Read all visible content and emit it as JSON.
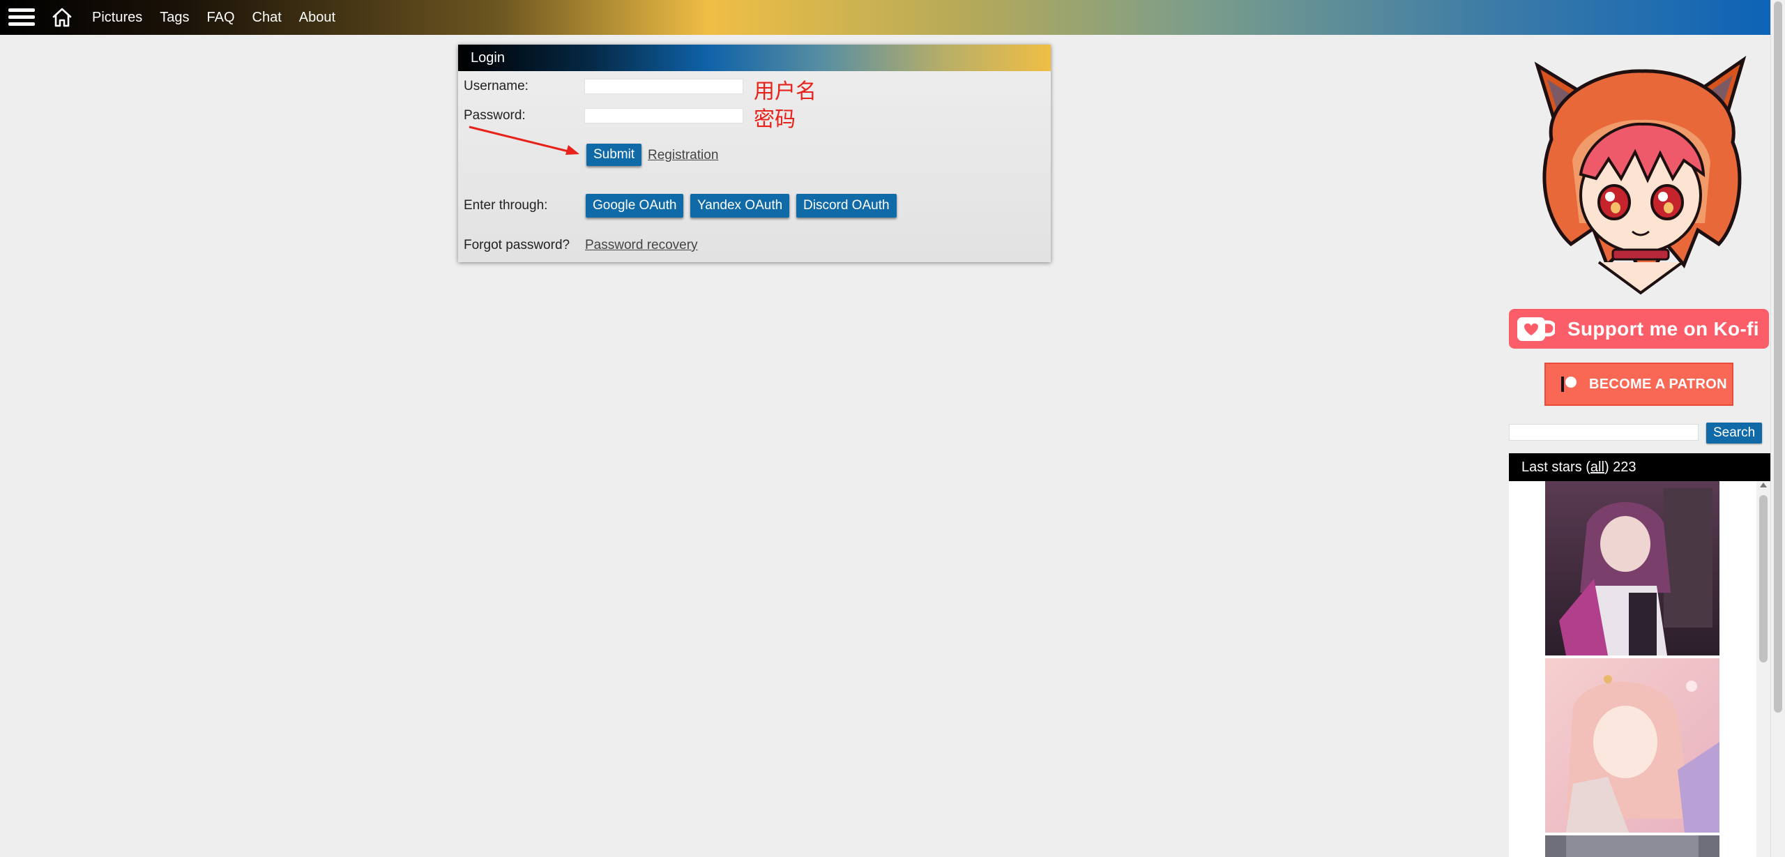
{
  "nav": {
    "items": [
      "Pictures",
      "Tags",
      "FAQ",
      "Chat",
      "About"
    ]
  },
  "login": {
    "title": "Login",
    "username_label": "Username:",
    "username_value": "",
    "username_annotation": "用户名",
    "password_label": "Password:",
    "password_value": "",
    "password_annotation": "密码",
    "submit_label": "Submit",
    "registration_label": "Registration",
    "enter_through_label": "Enter through:",
    "oauth_buttons": [
      "Google OAuth",
      "Yandex OAuth",
      "Discord OAuth"
    ],
    "forgot_label": "Forgot password?",
    "recovery_label": "Password recovery"
  },
  "sidebar": {
    "kofi_label": "Support me on Ko-fi",
    "patreon_label": "BECOME A PATRON",
    "search_value": "",
    "search_button": "Search",
    "stars": {
      "prefix": "Last stars (",
      "all_link": "all",
      "suffix": ") 223"
    }
  },
  "colors": {
    "button_blue": "#106aa8",
    "annotation_red": "#e8221b",
    "kofi": "#fb5e69",
    "patreon": "#f96854"
  },
  "icons": [
    "menu-icon",
    "home-icon",
    "kofi-cup-icon",
    "patreon-logo-icon"
  ]
}
